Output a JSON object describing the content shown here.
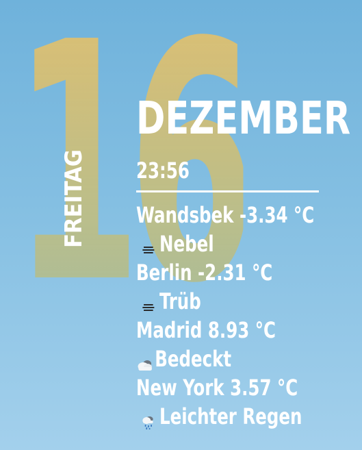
{
  "date": {
    "day": "16",
    "weekday": "FREITAG",
    "month": "DEZEMBER",
    "time": "23:56"
  },
  "colors": {
    "day_number": "#dcc070",
    "text": "#ffffff",
    "background_top": "#6fb2db",
    "background_bottom": "#a3d0ec"
  },
  "weather": [
    {
      "city_temp": "Wandsbek -3.34 °C",
      "condition": "Nebel",
      "icon": "fog-icon"
    },
    {
      "city_temp": "Berlin -2.31 °C",
      "condition": "Trüb",
      "icon": "fog-icon"
    },
    {
      "city_temp": "Madrid 8.93 °C",
      "condition": "Bedeckt",
      "icon": "cloud-icon"
    },
    {
      "city_temp": "New York 3.57 °C",
      "condition": "Leichter Regen",
      "icon": "rain-cloud-icon"
    }
  ]
}
